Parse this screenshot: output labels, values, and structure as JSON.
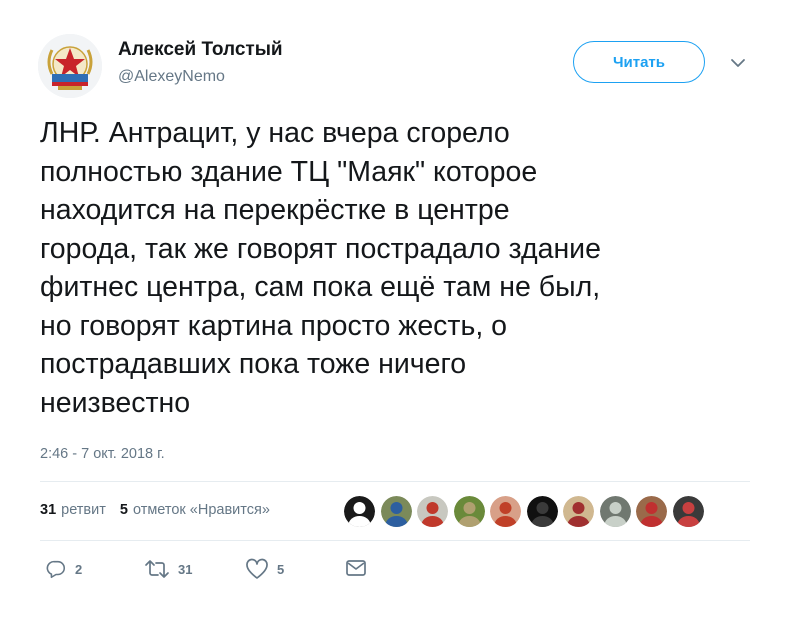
{
  "author": {
    "display_name": "Алексей Толстый",
    "handle": "@AlexeyNemo"
  },
  "follow_button": {
    "label": "Читать"
  },
  "tweet": {
    "lines": [
      "ЛНР. Антрацит, у нас вчера сгорело",
      "полностью здание ТЦ \"Маяк\" которое",
      "находится на перекрёстке в центре",
      "города, так же говорят пострадало здание",
      "фитнес центра, сам пока ещё там не был,",
      "но говорят картина просто жесть, о",
      "пострадавших пока тоже ничего",
      "неизвестно"
    ],
    "timestamp": "2:46 - 7 окт. 2018 г."
  },
  "stats": {
    "retweets_count": "31",
    "retweets_label": "ретвит",
    "likes_count": "5",
    "likes_label": "отметок «Нравится»"
  },
  "liker_avatars": [
    {
      "name": "liker-avatar-1",
      "color": "#1a1a1a",
      "accent": "#ffffff"
    },
    {
      "name": "liker-avatar-2",
      "color": "#7b8a5a",
      "accent": "#2d5fa0"
    },
    {
      "name": "liker-avatar-3",
      "color": "#c8c8c0",
      "accent": "#c0392b"
    },
    {
      "name": "liker-avatar-4",
      "color": "#6a8a3a",
      "accent": "#b0a070"
    },
    {
      "name": "liker-avatar-5",
      "color": "#d8a088",
      "accent": "#c04028"
    },
    {
      "name": "liker-avatar-6",
      "color": "#101010",
      "accent": "#3a3a3a"
    },
    {
      "name": "liker-avatar-7",
      "color": "#d0b890",
      "accent": "#a03030"
    },
    {
      "name": "liker-avatar-8",
      "color": "#707870",
      "accent": "#c8d0c8"
    },
    {
      "name": "liker-avatar-9",
      "color": "#9a6a4a",
      "accent": "#c03030"
    },
    {
      "name": "liker-avatar-10",
      "color": "#3a3a3a",
      "accent": "#c84040"
    }
  ],
  "actions": {
    "reply_count": "2",
    "retweet_count": "31",
    "like_count": "5"
  },
  "colors": {
    "accent": "#1da1f2",
    "text": "#14171a",
    "secondary": "#657786",
    "divider": "#e6ecf0"
  },
  "icons": [
    "chevron-down-icon",
    "reply-icon",
    "retweet-icon",
    "heart-icon",
    "envelope-icon"
  ]
}
